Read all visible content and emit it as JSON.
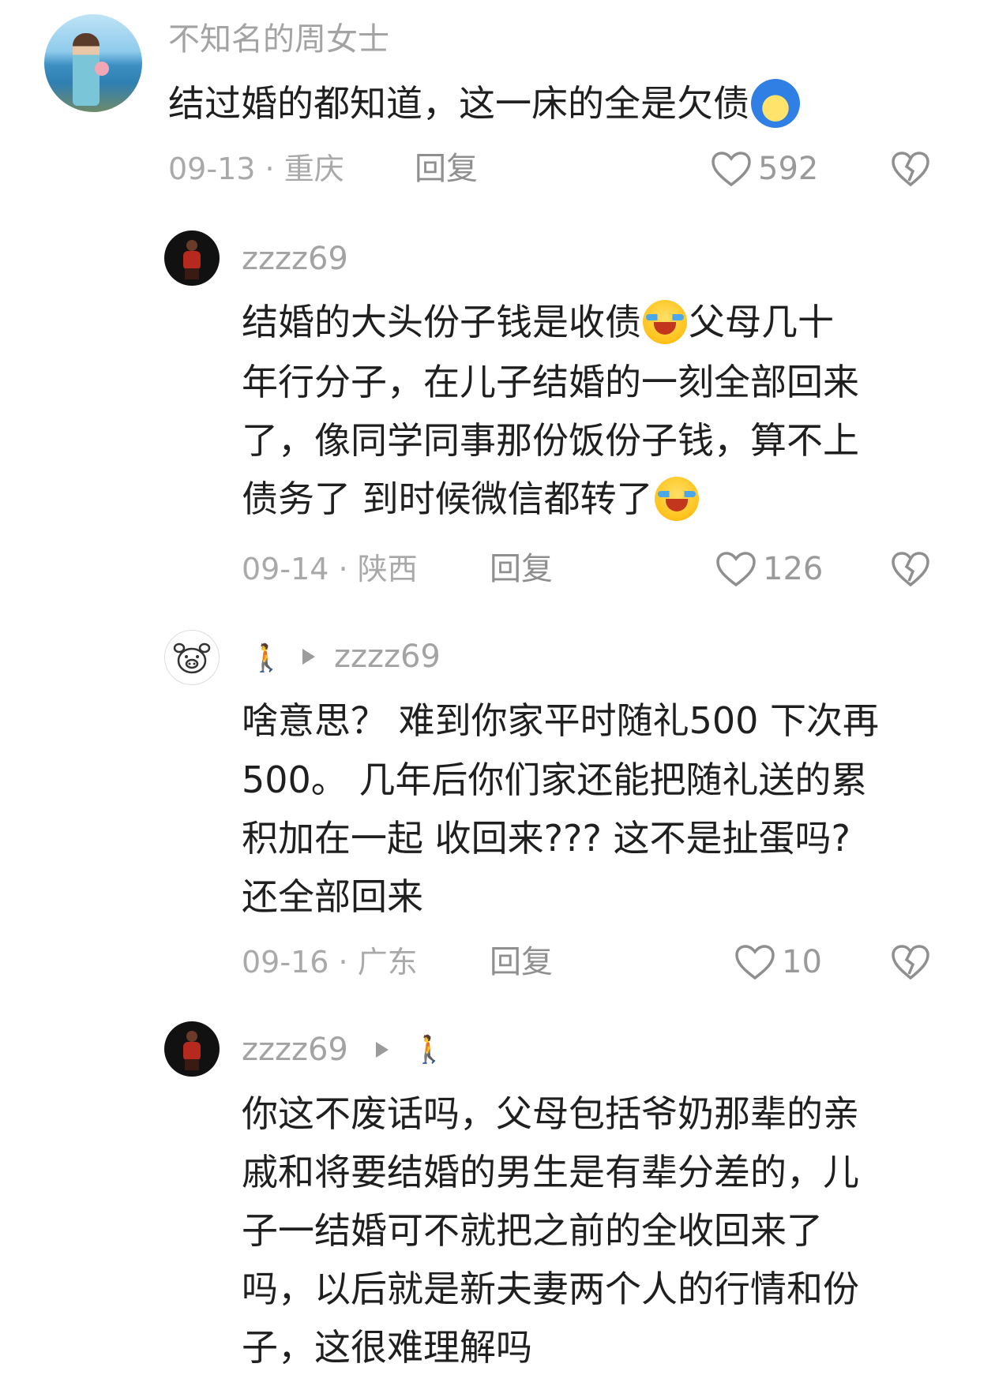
{
  "comments": [
    {
      "author": "不知名的周女士",
      "body_lines": [
        "结过婚的都知道，这一床的全是欠债"
      ],
      "date": "09-13",
      "dot": "·",
      "region": "重庆",
      "reply_label": "回复",
      "likes": "592"
    },
    {
      "author": "zzzz69",
      "body_lines": [
        "结婚的大头份子钱是收债",
        "父母几十",
        "年行分子，在儿子结婚的一刻全部回来",
        "了，像同学同事那份饭份子钱，算不上",
        "债务了 到时候微信都转了"
      ],
      "date": "09-14",
      "dot": "·",
      "region": "陕西",
      "reply_label": "回复",
      "likes": "126"
    },
    {
      "reply_to": "zzzz69",
      "body_lines": [
        "啥意思？ 难到你家平时随礼500 下次再",
        "500。 几年后你们家还能把随礼送的累",
        "积加在一起 收回来??? 这不是扯蛋吗?",
        "还全部回来"
      ],
      "date": "09-16",
      "dot": "·",
      "region": "广东",
      "reply_label": "回复",
      "likes": "10"
    },
    {
      "author": "zzzz69",
      "body_lines": [
        "你这不废话吗，父母包括爷奶那辈的亲",
        "戚和将要结婚的男生是有辈分差的，儿",
        "子一结婚可不就把之前的全收回来了",
        "吗，以后就是新夫妻两个人的行情和份",
        "子，这很难理解吗"
      ]
    }
  ],
  "icons": {
    "like": "heart-outline-icon",
    "dislike": "broken-heart-icon",
    "walker": "walking-person-emoji",
    "reply_arrow": "triangle-right-icon",
    "laugh": "laughing-tears-emoji",
    "blue_face": "blue-hair-face-emoji"
  }
}
